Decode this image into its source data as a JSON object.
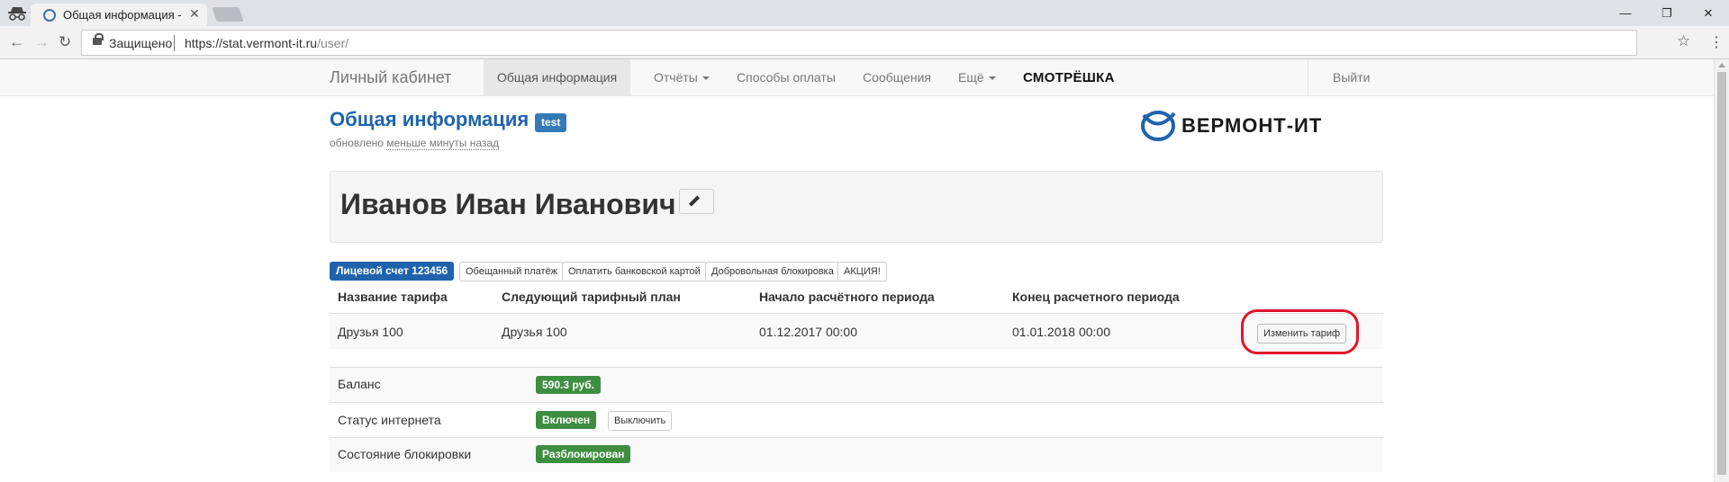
{
  "browser": {
    "tab_title": "Общая информация - Л",
    "secure_label": "Защищено",
    "url_host": "https://stat.vermont-it.ru",
    "url_path": "/user/"
  },
  "navbar": {
    "brand": "Личный кабинет",
    "items": [
      {
        "label": "Общая информация",
        "active": true
      },
      {
        "label": "Отчёты",
        "dropdown": true
      },
      {
        "label": "Способы оплаты"
      },
      {
        "label": "Сообщения"
      },
      {
        "label": "Ещё",
        "dropdown": true
      }
    ],
    "partner_logo": "СМОТРЁШКА",
    "logout": "Выйти"
  },
  "header": {
    "title": "Общая информация",
    "badge": "test",
    "updated_prefix": "обновлено",
    "updated_link": "меньше минуты назад",
    "logo_text": "ВЕРМОНТ-ИТ"
  },
  "user": {
    "full_name": "Иванов Иван Иванович"
  },
  "actions": {
    "account": "Лицевой счет 123456",
    "buttons": [
      "Обещанный платёж",
      "Оплатить банковской картой",
      "Добровольная блокировка",
      "АКЦИЯ!"
    ]
  },
  "tariff_table": {
    "headers": [
      "Название тарифа",
      "Следующий тарифный план",
      "Начало расчётного периода",
      "Конец расчетного периода"
    ],
    "row": [
      "Друзья 100",
      "Друзья 100",
      "01.12.2017 00:00",
      "01.01.2018 00:00"
    ],
    "change_button": "Изменить тариф"
  },
  "info_table": {
    "balance_label": "Баланс",
    "balance_value": "590.3 руб.",
    "internet_label": "Статус интернета",
    "internet_value": "Включен",
    "internet_button": "Выключить",
    "block_label": "Состояние блокировки",
    "block_value": "Разблокирован"
  },
  "colors": {
    "brand_blue": "#1f63ad",
    "success_green": "#3e8e41",
    "highlight_red": "#e0152b"
  }
}
